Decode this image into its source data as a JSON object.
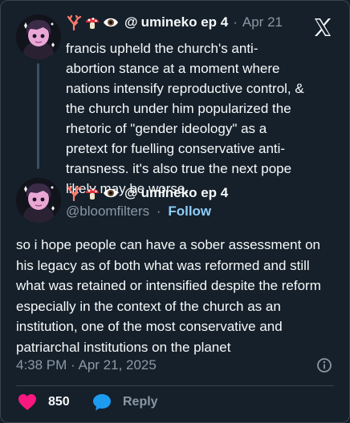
{
  "quoted_tweet": {
    "name": "umineko ep 4",
    "emoji_prefix": [
      "coral-emoji",
      "mushroom-emoji",
      "eye-emoji",
      "at-symbol"
    ],
    "at_symbol": "@",
    "separator": "·",
    "date": "Apr 21",
    "text": "francis upheld the church's anti-abortion stance at a moment where nations intensify reproductive control, & the church under him popularized the rhetoric of \"gender ideology\" as a pretext for fuelling conservative anti-transness. it's also true the next pope likely may be worse."
  },
  "main_tweet": {
    "name": "umineko ep 4",
    "at_symbol": "@",
    "handle": "@bloomfilters",
    "separator": "·",
    "follow_label": "Follow",
    "text": "so i hope people can have a sober assessment on his legacy as of both what was reformed and still what was retained or intensified despite the reform especially in the context of the church as an institution, one of the most conservative and patriarchal institutions on the planet",
    "timestamp": "4:38 PM · Apr 21, 2025",
    "likes": "850",
    "reply_label": "Reply"
  },
  "icons": {
    "brand": "x-logo-icon",
    "info": "info-icon",
    "like": "heart-icon",
    "reply": "speech-bubble-icon"
  },
  "colors": {
    "background": "#15202b",
    "text": "#f7f9f9",
    "muted": "#8b98a5",
    "link": "#8ecdf8",
    "like": "#f91880",
    "reply": "#1d9bf0",
    "border": "#38444d"
  }
}
